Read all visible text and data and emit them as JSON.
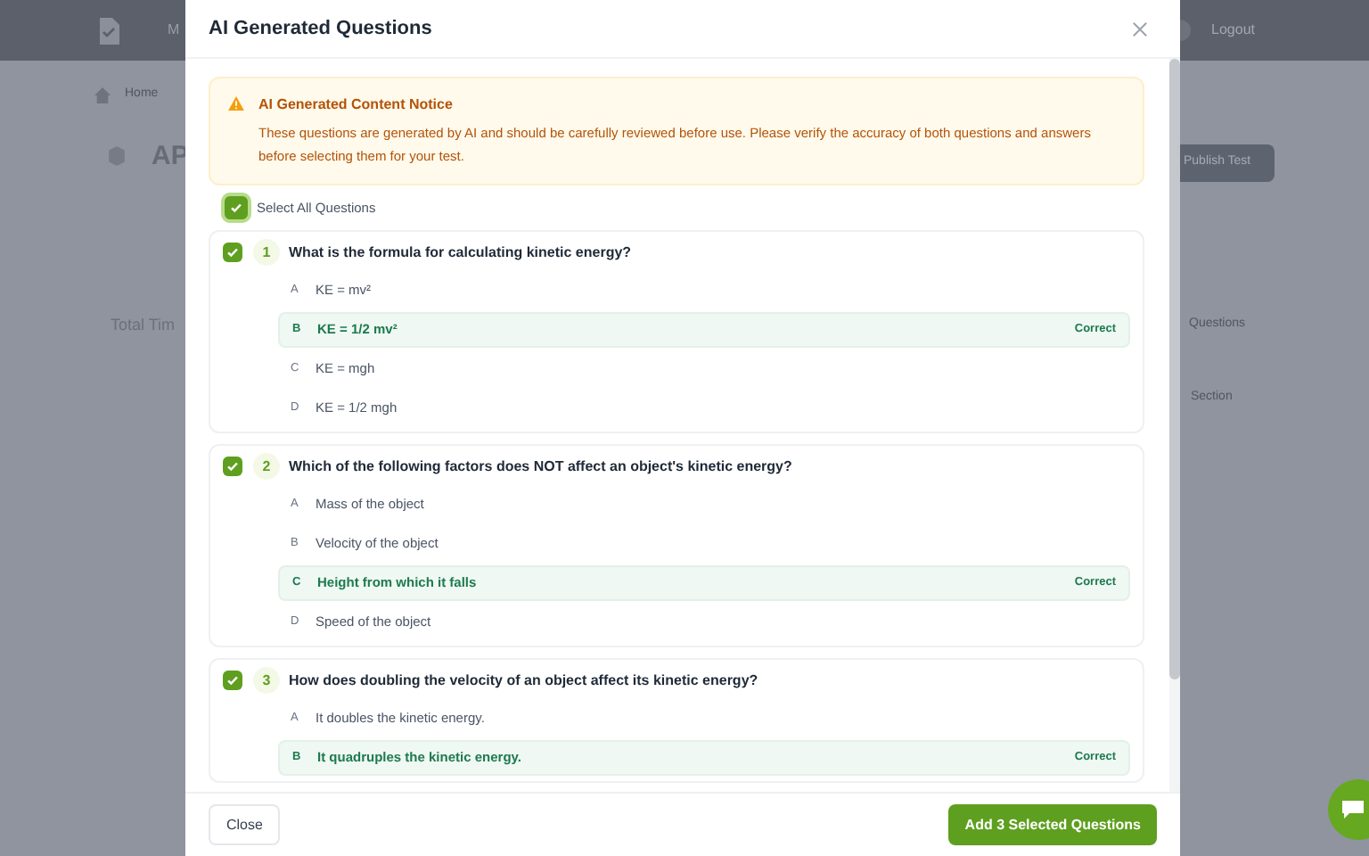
{
  "background": {
    "nav_text": "M",
    "logout": "Logout",
    "breadcrumb": "Home",
    "page_title": "AP",
    "publish_button": "Publish Test",
    "total_time": "Total Tim",
    "questions_label": "Questions",
    "section_label": "Section"
  },
  "dialog": {
    "title": "AI Generated Questions",
    "notice": {
      "title": "AI Generated Content Notice",
      "text": "These questions are generated by AI and should be carefully reviewed before use. Please verify the accuracy of both questions and answers before selecting them for your test."
    },
    "select_all": {
      "label": "Select All Questions",
      "checked": true
    },
    "questions": [
      {
        "number": "1",
        "text": "What is the formula for calculating kinetic energy?",
        "checked": true,
        "options": [
          {
            "letter": "A",
            "text": "KE = mv²",
            "correct": false
          },
          {
            "letter": "B",
            "text": "KE = 1/2 mv²",
            "correct": true,
            "badge": "Correct"
          },
          {
            "letter": "C",
            "text": "KE = mgh",
            "correct": false
          },
          {
            "letter": "D",
            "text": "KE = 1/2 mgh",
            "correct": false
          }
        ]
      },
      {
        "number": "2",
        "text": "Which of the following factors does NOT affect an object's kinetic energy?",
        "checked": true,
        "options": [
          {
            "letter": "A",
            "text": "Mass of the object",
            "correct": false
          },
          {
            "letter": "B",
            "text": "Velocity of the object",
            "correct": false
          },
          {
            "letter": "C",
            "text": "Height from which it falls",
            "correct": true,
            "badge": "Correct"
          },
          {
            "letter": "D",
            "text": "Speed of the object",
            "correct": false
          }
        ]
      },
      {
        "number": "3",
        "text": "How does doubling the velocity of an object affect its kinetic energy?",
        "checked": true,
        "options": [
          {
            "letter": "A",
            "text": "It doubles the kinetic energy.",
            "correct": false
          },
          {
            "letter": "B",
            "text": "It quadruples the kinetic energy.",
            "correct": true,
            "badge": "Correct"
          }
        ]
      }
    ],
    "close_button": "Close",
    "add_button": "Add 3 Selected Questions"
  }
}
